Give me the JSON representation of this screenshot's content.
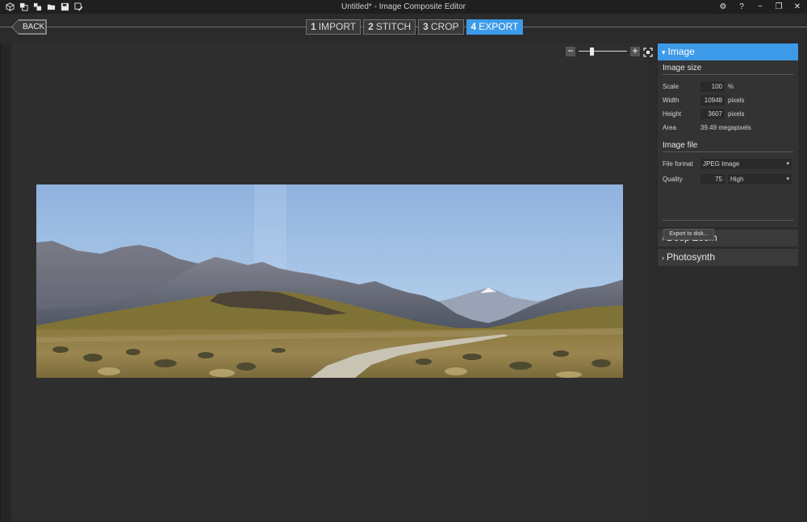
{
  "window": {
    "title": "Untitled* - Image Composite Editor",
    "toolbar_icons": [
      "new-project-icon",
      "new-panorama-icon",
      "new-panorama-from-video-icon",
      "open-folder-icon",
      "save-icon",
      "save-as-icon"
    ],
    "controls": {
      "settings": "⚙",
      "help": "?",
      "minimize": "−",
      "restore": "❐",
      "close": "✕"
    }
  },
  "stepbar": {
    "back_label": "BACK",
    "steps": [
      {
        "num": "1",
        "label": "IMPORT"
      },
      {
        "num": "2",
        "label": "STITCH"
      },
      {
        "num": "3",
        "label": "CROP"
      },
      {
        "num": "4",
        "label": "EXPORT"
      }
    ],
    "active_step": 4
  },
  "zoom": {
    "minus": "−",
    "plus": "+",
    "level": 0.25
  },
  "panel": {
    "image": {
      "header": "Image",
      "size_group": "Image size",
      "scale_label": "Scale",
      "scale_value": "100",
      "scale_unit": "%",
      "width_label": "Width",
      "width_value": "10948",
      "width_unit": "pixels",
      "height_label": "Height",
      "height_value": "3607",
      "height_unit": "pixels",
      "area_label": "Area",
      "area_value": "39.49 megapixels",
      "file_group": "Image file",
      "format_label": "File format",
      "format_value": "JPEG Image",
      "quality_label": "Quality",
      "quality_value": "75",
      "quality_level": "High",
      "export_label": "Export to disk..."
    },
    "deep_zoom": {
      "header": "Deep Zoom"
    },
    "photosynth": {
      "header": "Photosynth"
    }
  },
  "colors": {
    "accent": "#3d9ae8",
    "background": "#2b2b2b",
    "panel": "#333333"
  }
}
